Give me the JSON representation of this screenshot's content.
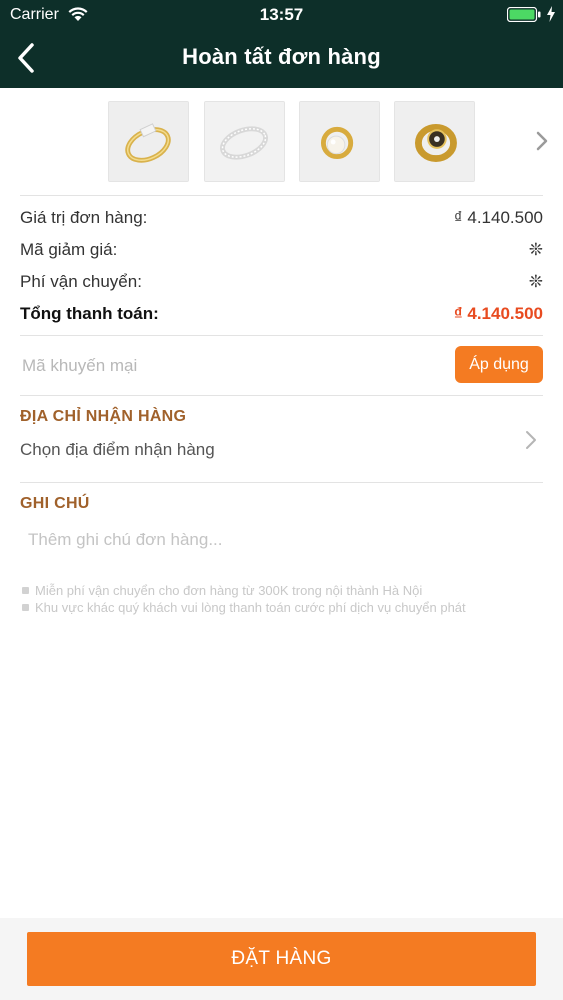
{
  "status_bar": {
    "carrier": "Carrier",
    "time": "13:57"
  },
  "nav": {
    "title": "Hoàn tất đơn hàng"
  },
  "products": [
    {
      "icon": "ring-diamond-band-icon"
    },
    {
      "icon": "ring-eternity-band-icon"
    },
    {
      "icon": "pearl-earring-icon"
    },
    {
      "icon": "gold-signet-ring-icon"
    }
  ],
  "summary": {
    "order_value_label": "Giá trị đơn hàng:",
    "order_value": "₫ 4.140.500",
    "discount_label": "Mã giảm giá:",
    "discount_value": "❊",
    "shipping_label": "Phí vận chuyển:",
    "shipping_value": "❊",
    "total_label": "Tổng thanh toán:",
    "total_value": "₫ 4.140.500"
  },
  "promo": {
    "placeholder": "Mã khuyến mại",
    "apply_label": "Áp dụng"
  },
  "address": {
    "section_title": "ĐỊA CHỈ NHẬN HÀNG",
    "select_label": "Chọn địa điểm nhận hàng"
  },
  "note": {
    "section_title": "GHI CHÚ",
    "placeholder": "Thêm ghi chú đơn hàng..."
  },
  "notices": [
    "Miễn phí vận chuyển cho đơn hàng từ 300K trong nội thành Hà Nội",
    "Khu vực khác quý khách vui lòng thanh toán cước phí dịch vụ chuyển phát"
  ],
  "footer": {
    "order_button_label": "ĐẶT HÀNG"
  },
  "colors": {
    "header_bg": "#0d2f29",
    "accent": "#f47b22",
    "total_red": "#e84b20",
    "section_brown": "#a0612b"
  }
}
